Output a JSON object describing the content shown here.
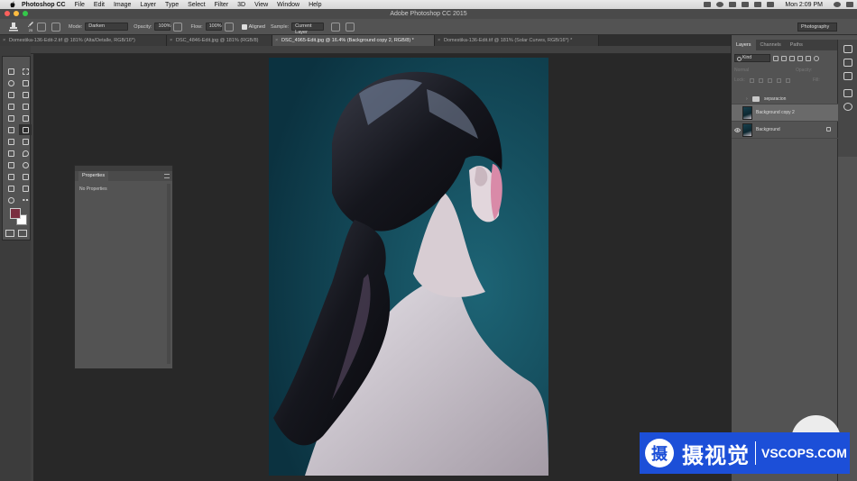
{
  "menubar": {
    "app_name": "Photoshop CC",
    "items": [
      "File",
      "Edit",
      "Image",
      "Layer",
      "Type",
      "Select",
      "Filter",
      "3D",
      "View",
      "Window",
      "Help"
    ],
    "clock": "Mon 2:09 PM"
  },
  "window": {
    "title": "Adobe Photoshop CC 2015"
  },
  "options": {
    "brush_size": "25",
    "mode_label": "Mode:",
    "mode_value": "Darken",
    "opacity_label": "Opacity:",
    "opacity_value": "100%",
    "flow_label": "Flow:",
    "flow_value": "100%",
    "aligned_label": "Aligned",
    "sample_label": "Sample:",
    "sample_value": "Current Layer",
    "workspace": "Photography"
  },
  "tabs": [
    {
      "label": "Domestika-136-Edit-2.tif @ 181% (Alta/Detalle, RGB/16*)"
    },
    {
      "label": "DSC_4846-Edit.jpg @ 181% (RGB/8)"
    },
    {
      "label": "DSC_4965-Edit.jpg @ 16.4% (Background copy 2, RGB/8) *"
    },
    {
      "label": "Domestika-136-Edit.tif @ 181% (Solar Curves, RGB/16*) *"
    }
  ],
  "properties": {
    "title": "Properties",
    "body": "No Properties"
  },
  "layers_panel": {
    "tabs": [
      "Layers",
      "Channels",
      "Paths"
    ],
    "filter_kind": "Kind",
    "blend_mode": "Normal",
    "opacity_label": "Opacity:",
    "lock_label": "Lock:",
    "fill_label": "Fill:",
    "layers": [
      {
        "name": "separacion",
        "type": "group"
      },
      {
        "name": "Background copy 2",
        "type": "pixel",
        "selected": true
      },
      {
        "name": "Background",
        "type": "pixel",
        "locked": true
      }
    ]
  },
  "colors": {
    "foreground": "#7a2e3f",
    "background": "#ffffff",
    "watermark": "#1c4fd8"
  },
  "watermark": {
    "mark": "摄",
    "cn": "摄视觉",
    "en": "VSCOPS.COM"
  }
}
